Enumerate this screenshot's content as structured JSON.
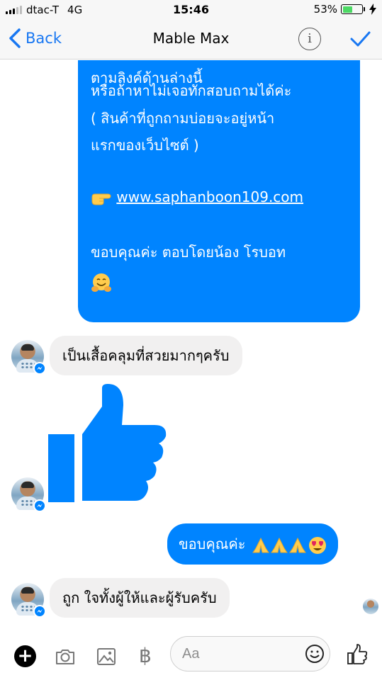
{
  "status_bar": {
    "carrier": "dtac-T",
    "network": "4G",
    "time": "15:46",
    "battery": "53%",
    "battery_level": 0.53
  },
  "nav": {
    "back_label": "Back",
    "title": "Mable Max"
  },
  "messages": {
    "outgoing_long": {
      "line1": "ตามลิงค์ด้านล่างนี้",
      "line2": "หรือถ้าหาไม่เจอทักสอบถามได้ค่ะ",
      "line3": "( สินค้าที่ถูกถามบ่อยจะอยู่หน้า",
      "line4": "แรกของเว็บไซต์ )",
      "link": "www.saphanboon109.com",
      "line5": "ขอบคุณค่ะ ตอบโดยน้อง โรบอท"
    },
    "incoming_1": "เป็นเสื้อคลุมที่สวยมากๆครับ",
    "outgoing_thanks": "ขอบคุณค่ะ",
    "incoming_2": "ถูก ใจทั้งผู้ให้และผู้รับครับ"
  },
  "composer": {
    "placeholder": "Aa"
  },
  "colors": {
    "messenger_blue": "#0084ff",
    "incoming_bubble": "#f1f0f0",
    "battery_green": "#4cd964",
    "nav_blue": "#1877f2"
  },
  "icons": [
    "signal-icon",
    "battery-icon",
    "charging-icon",
    "back-chevron-icon",
    "info-icon",
    "checkmark-icon",
    "pointing-hand-emoji",
    "hugging-face-emoji",
    "thumbs-up-sticker",
    "folded-hands-emoji",
    "heart-eyes-emoji",
    "messenger-badge-icon",
    "plus-icon",
    "camera-icon",
    "gallery-icon",
    "baht-icon",
    "emoji-icon",
    "like-icon"
  ]
}
